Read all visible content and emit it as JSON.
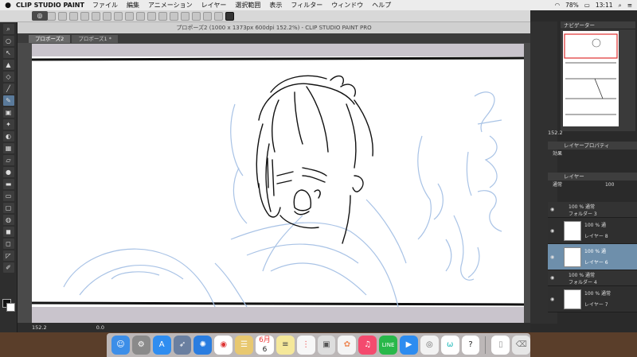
{
  "menubar": {
    "app_name": "CLIP STUDIO PAINT",
    "items": [
      "ファイル",
      "編集",
      "アニメーション",
      "レイヤー",
      "選択範囲",
      "表示",
      "フィルター",
      "ウィンドウ",
      "ヘルプ"
    ],
    "battery": "78%",
    "time": "13:11"
  },
  "window": {
    "title": "プロポーズ2 (1000 x 1373px 600dpi 152.2%) - CLIP STUDIO PAINT PRO",
    "tabs": [
      "プロポーズ2",
      "プロポーズ1 *"
    ],
    "status_zoom": "152.2",
    "status_angle": "0.0"
  },
  "navigator": {
    "title": "ナビゲーター",
    "zoom": "152.2"
  },
  "layer_property": {
    "title": "レイヤープロパティ",
    "effect_label": "効果"
  },
  "layer_panel": {
    "title": "レイヤー",
    "blend_mode": "通常",
    "opacity": "100",
    "layers": [
      {
        "type": "folder",
        "line1": "100 % 通常",
        "line2": "フォルダー 3"
      },
      {
        "type": "layer",
        "line1": "100 % 通",
        "line2": "レイヤー 8"
      },
      {
        "type": "layer",
        "line1": "100 % 通",
        "line2": "レイヤー 6",
        "selected": true
      },
      {
        "type": "folder",
        "line1": "100 % 通常",
        "line2": "フォルダー 4"
      },
      {
        "type": "layer",
        "line1": "100 % 通常",
        "line2": "レイヤー 7"
      }
    ]
  },
  "dock": {
    "calendar_day": "6",
    "calendar_month": "6月",
    "badge": "1"
  },
  "colors": {
    "selected_layer": "#6e8fab",
    "sketch_blue": "#a9c3e6",
    "ink": "#111111"
  }
}
